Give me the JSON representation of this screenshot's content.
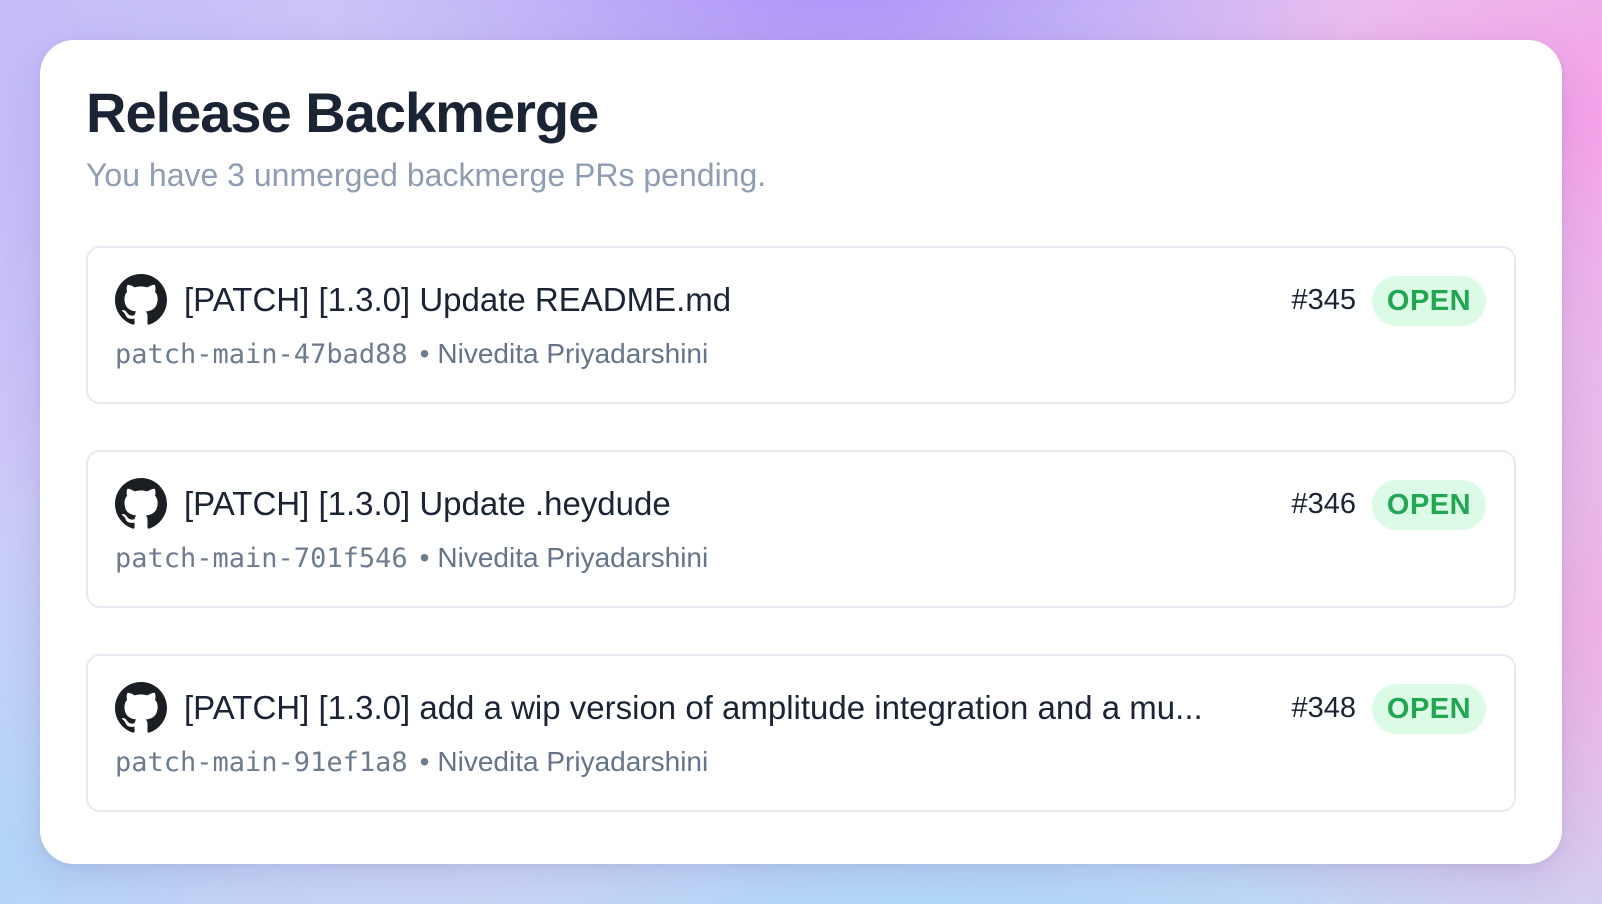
{
  "header": {
    "title": "Release Backmerge",
    "subtitle": "You have 3 unmerged backmerge PRs pending."
  },
  "pull_requests": [
    {
      "icon": "github-icon",
      "title": "[PATCH] [1.3.0] Update README.md",
      "number": "#345",
      "status": "OPEN",
      "branch": "patch-main-47bad88",
      "separator": "•",
      "author": "Nivedita Priyadarshini"
    },
    {
      "icon": "github-icon",
      "title": "[PATCH] [1.3.0] Update .heydude",
      "number": "#346",
      "status": "OPEN",
      "branch": "patch-main-701f546",
      "separator": "•",
      "author": "Nivedita Priyadarshini"
    },
    {
      "icon": "github-icon",
      "title": "[PATCH] [1.3.0] add a wip version of amplitude integration and a mu...",
      "number": "#348",
      "status": "OPEN",
      "branch": "patch-main-91ef1a8",
      "separator": "•",
      "author": "Nivedita Priyadarshini"
    }
  ],
  "colors": {
    "title": "#1b2435",
    "subtitle": "#8e9db3",
    "status_text": "#1fa851",
    "status_bg": "#dcfbe6",
    "border": "#e6ebf2"
  }
}
